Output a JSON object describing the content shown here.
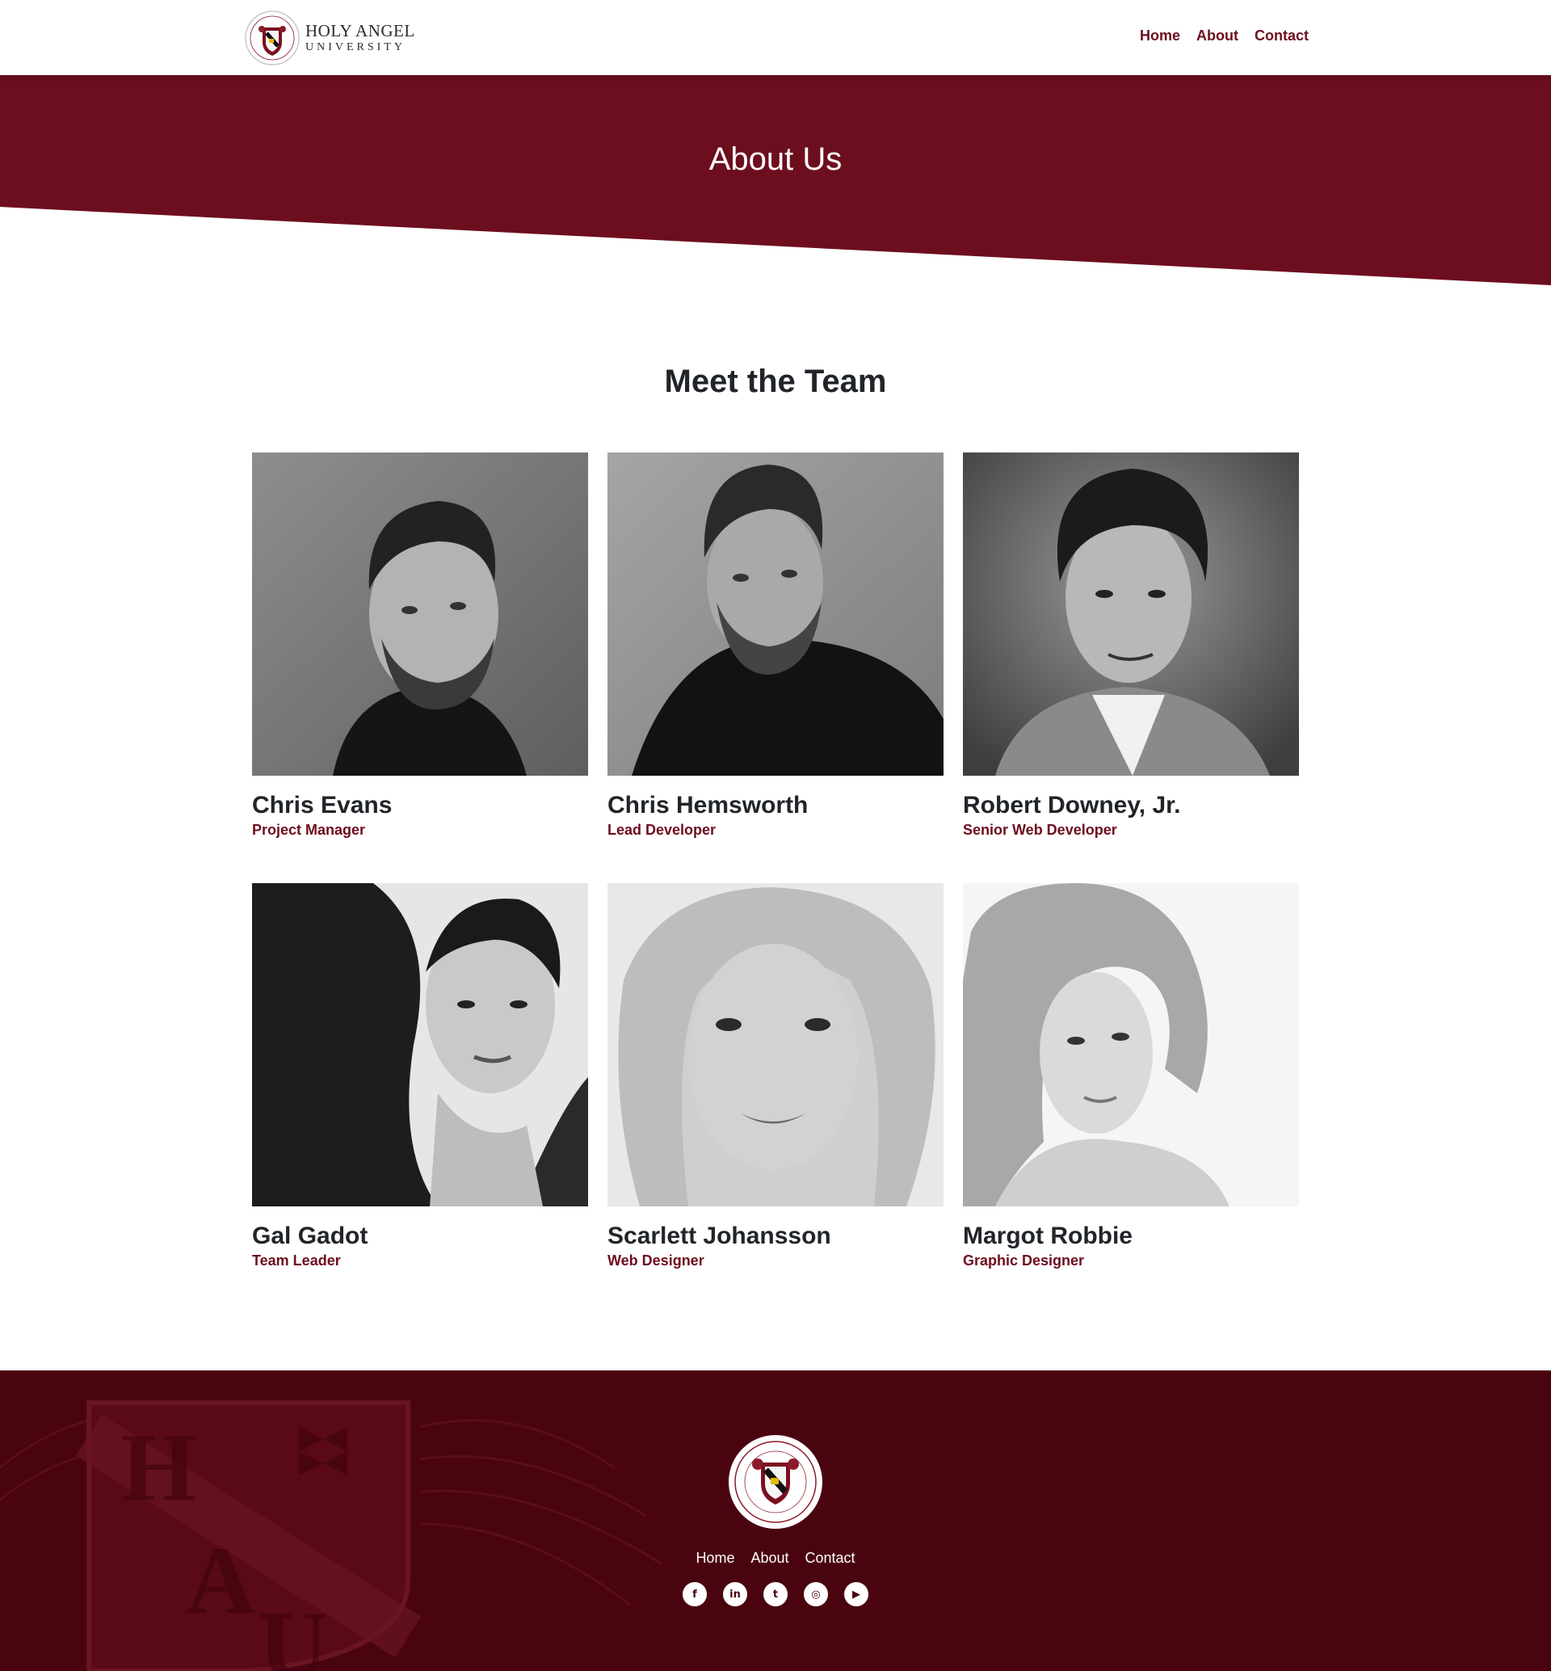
{
  "brand": {
    "line1": "HOLY ANGEL",
    "line2": "UNIVERSITY",
    "seal_text_top": "LAUS DEO SEMPER",
    "seal_text_bottom": "HOLY ANGEL UNIVERSITY"
  },
  "nav": {
    "links": [
      "Home",
      "About",
      "Contact"
    ]
  },
  "hero": {
    "title": "About Us"
  },
  "team": {
    "title": "Meet the Team",
    "members": [
      {
        "name": "Chris Evans",
        "role": "Project Manager"
      },
      {
        "name": "Chris Hemsworth",
        "role": "Lead Developer"
      },
      {
        "name": "Robert Downey, Jr.",
        "role": "Senior Web Developer"
      },
      {
        "name": "Gal Gadot",
        "role": "Team Leader"
      },
      {
        "name": "Scarlett Johansson",
        "role": "Web Designer"
      },
      {
        "name": "Margot Robbie",
        "role": "Graphic Designer"
      }
    ]
  },
  "footer": {
    "crest_letters": "HAU",
    "links": [
      "Home",
      "About",
      "Contact"
    ],
    "social": [
      {
        "icon": "facebook-icon",
        "glyph": "f"
      },
      {
        "icon": "linkedin-icon",
        "glyph": "in"
      },
      {
        "icon": "twitter-icon",
        "glyph": "t"
      },
      {
        "icon": "instagram-icon",
        "glyph": "◎"
      },
      {
        "icon": "youtube-icon",
        "glyph": "▶"
      }
    ]
  },
  "colors": {
    "brand_maroon": "#6d0e1e",
    "footer_maroon": "#4a0410",
    "text_dark": "#212529"
  }
}
